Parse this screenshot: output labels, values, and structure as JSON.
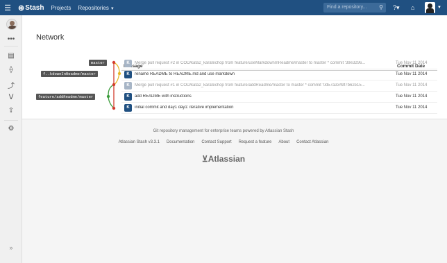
{
  "header": {
    "brand": "Stash",
    "nav": [
      {
        "label": "Projects"
      },
      {
        "label": "Repositories"
      }
    ],
    "search_placeholder": "Find a repository..."
  },
  "page": {
    "title": "Network"
  },
  "table": {
    "columns": [
      "Message",
      "Commit Date"
    ],
    "rows": [
      {
        "badge": "K",
        "message": "Merge pull request #2 in COD/kata2_karatechop from feature/useMarkdownInReadme/master to master * commit '39e3296...",
        "date": "Tue Nov 11 2014",
        "merge": true
      },
      {
        "badge": "K",
        "message": "rename README to README.md and use markdown",
        "date": "Tue Nov 11 2014",
        "merge": false
      },
      {
        "badge": "K",
        "message": "Merge pull request #1 in COD/kata2_karatechop from feature/addReadme/master to master * commit '0d57a3349f7b62e15...",
        "date": "Tue Nov 11 2014",
        "merge": true
      },
      {
        "badge": "K",
        "message": "add README with instructions",
        "date": "Tue Nov 11 2014",
        "merge": false
      },
      {
        "badge": "K",
        "message": "initial commit and day1 day1: iterative implementation",
        "date": "Tue Nov 11 2014",
        "merge": false
      }
    ]
  },
  "branches": {
    "master": "master",
    "markdown": "f..kdownInReadme/master",
    "readme": "feature/addReadme/master"
  },
  "graph_colors": {
    "master": "#d33c2e",
    "markdown": "#e8b726",
    "readme": "#3c9c3c"
  },
  "footer": {
    "tagline": "Git repository management for enterprise teams powered by Atlassian Stash",
    "links": [
      "Atlassian Stash v3.3.1",
      "Documentation",
      "Contact Support",
      "Request a feature",
      "About",
      "Contact Atlassian"
    ],
    "logo": "Atlassian"
  }
}
